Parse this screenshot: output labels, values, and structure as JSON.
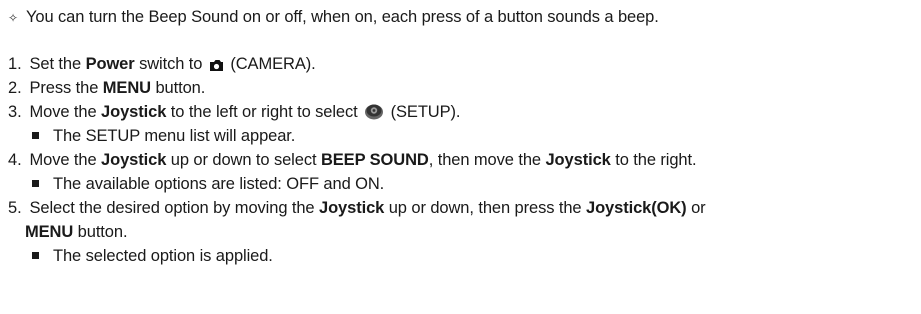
{
  "intro": "You can turn the Beep Sound on or off, when on, each press of a button sounds a beep.",
  "steps": [
    {
      "num": "1.",
      "a": "Set the ",
      "b1": "Power",
      "c": " switch to ",
      "icon": "camera-icon",
      "d": " (CAMERA)."
    },
    {
      "num": "2.",
      "a": "Press the ",
      "b1": "MENU",
      "c": " button."
    },
    {
      "num": "3.",
      "a": "Move the ",
      "b1": "Joystick",
      "c": " to the left or right to select ",
      "icon": "setup-icon",
      "d": " (SETUP).",
      "note": "The SETUP menu list will appear."
    },
    {
      "num": "4.",
      "a": "Move the ",
      "b1": "Joystick",
      "c": " up or down to select ",
      "b2": "BEEP SOUND",
      "d": ", then move the ",
      "b3": "Joystick",
      "e": " to the right.",
      "note": "The available options are listed: OFF and ON."
    },
    {
      "num": "5.",
      "a": "Select the desired option by moving the ",
      "b1": "Joystick",
      "c": " up or down, then press the ",
      "b2": "Joystick(OK)",
      "d": " or",
      "line2_b": "MENU",
      "line2_rest": " button.",
      "note": "The selected option is applied."
    }
  ]
}
